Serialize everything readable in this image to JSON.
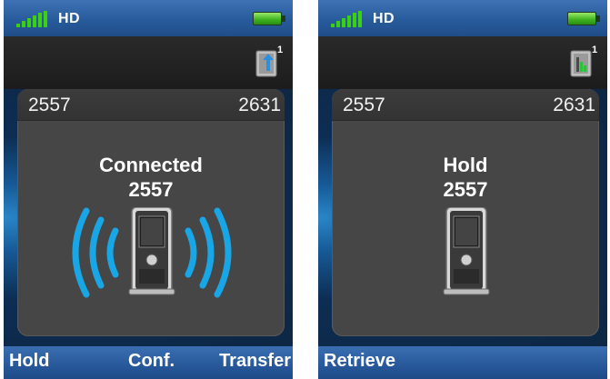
{
  "screens": [
    {
      "status_bar": {
        "signal_icon": "signal-bars-icon",
        "hd_label": "HD",
        "battery_icon": "battery-full-icon"
      },
      "queue_icon": "call-transfer-queue-icon",
      "queue_badge": "1",
      "line_left": "2557",
      "line_right": "2631",
      "status": "Connected",
      "number": "2557",
      "graphic": "phone-ringing-waves-icon",
      "softkeys": {
        "left": "Hold",
        "center": "Conf.",
        "right": "Transfer"
      }
    },
    {
      "status_bar": {
        "signal_icon": "signal-bars-icon",
        "hd_label": "HD",
        "battery_icon": "battery-full-icon"
      },
      "queue_icon": "call-hold-queue-icon",
      "queue_badge": "1",
      "line_left": "2557",
      "line_right": "2631",
      "status": "Hold",
      "number": "2557",
      "graphic": "phone-icon",
      "softkeys": {
        "left": "Retrieve"
      }
    }
  ],
  "colors": {
    "status_bar_blue": "#285b9c",
    "panel_gray": "#464646",
    "wave_blue": "#19a6e6",
    "battery_green": "#3cb21d",
    "signal_green": "#3ad10f"
  }
}
